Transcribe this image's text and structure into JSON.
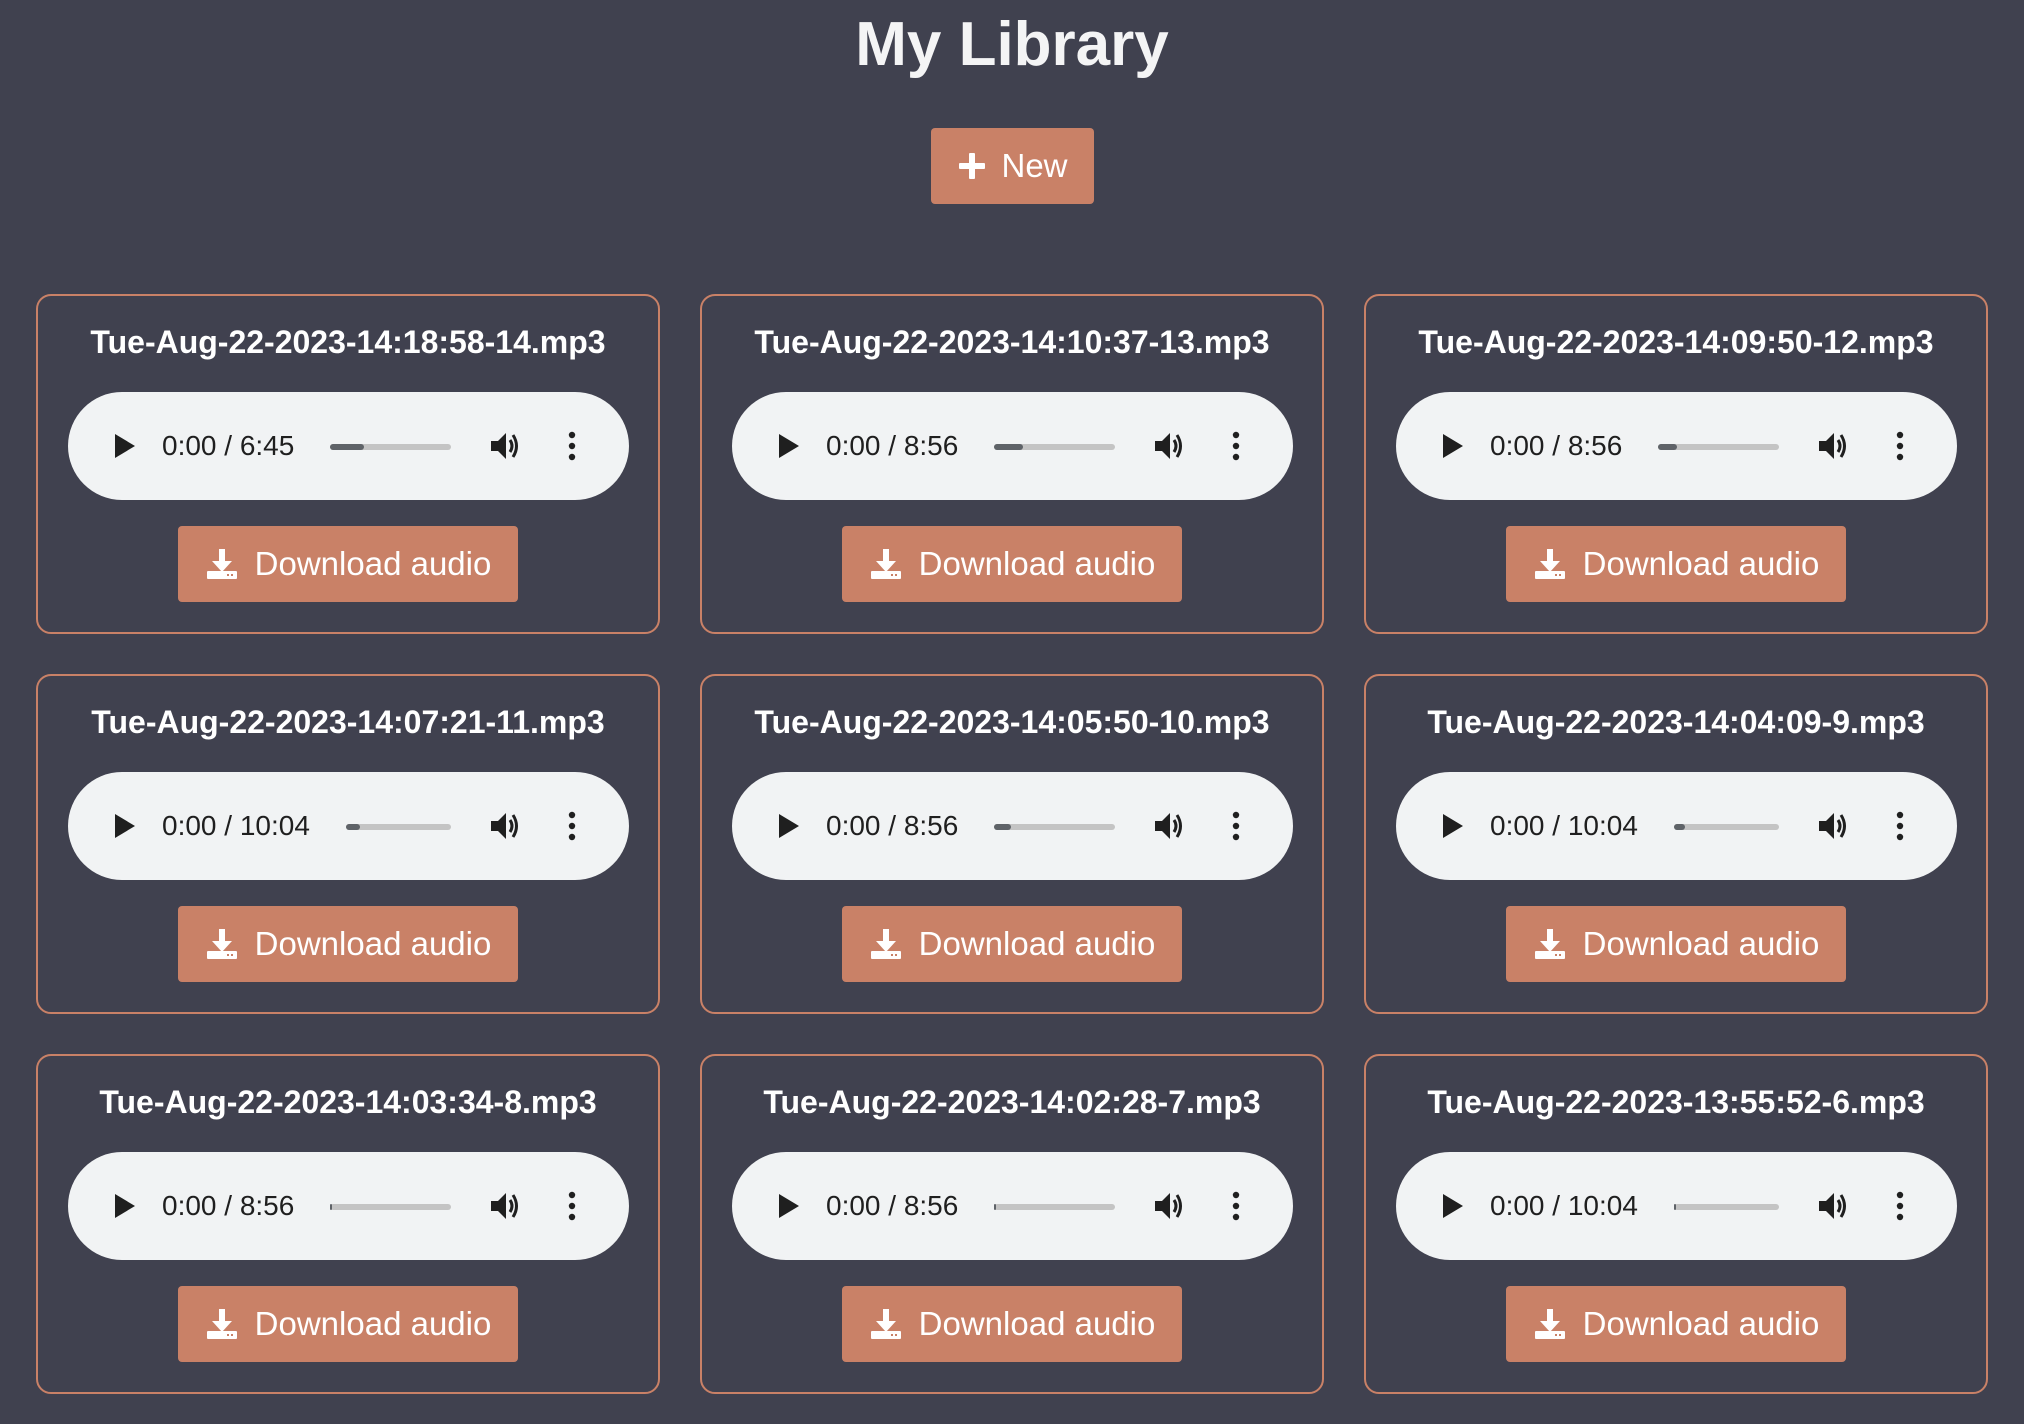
{
  "header": {
    "title": "My Library",
    "new_button_label": "New"
  },
  "colors": {
    "background": "#40414f",
    "accent": "#c98167",
    "player_background": "#f1f3f4"
  },
  "icons": {
    "new_button": "plus-icon",
    "download": "download-icon",
    "play": "play-icon",
    "volume": "volume-icon",
    "more": "more-vertical-icon"
  },
  "recordings": [
    {
      "filename": "Tue-Aug-22-2023-14:18:58-14.mp3",
      "time": "0:00 / 6:45",
      "download_label": "Download audio",
      "buffered_percent": 28
    },
    {
      "filename": "Tue-Aug-22-2023-14:10:37-13.mp3",
      "time": "0:00 / 8:56",
      "download_label": "Download audio",
      "buffered_percent": 24
    },
    {
      "filename": "Tue-Aug-22-2023-14:09:50-12.mp3",
      "time": "0:00 / 8:56",
      "download_label": "Download audio",
      "buffered_percent": 16
    },
    {
      "filename": "Tue-Aug-22-2023-14:07:21-11.mp3",
      "time": "0:00 / 10:04",
      "download_label": "Download audio",
      "buffered_percent": 13
    },
    {
      "filename": "Tue-Aug-22-2023-14:05:50-10.mp3",
      "time": "0:00 / 8:56",
      "download_label": "Download audio",
      "buffered_percent": 14
    },
    {
      "filename": "Tue-Aug-22-2023-14:04:09-9.mp3",
      "time": "0:00 / 10:04",
      "download_label": "Download audio",
      "buffered_percent": 10
    },
    {
      "filename": "Tue-Aug-22-2023-14:03:34-8.mp3",
      "time": "0:00 / 8:56",
      "download_label": "Download audio",
      "buffered_percent": 2
    },
    {
      "filename": "Tue-Aug-22-2023-14:02:28-7.mp3",
      "time": "0:00 / 8:56",
      "download_label": "Download audio",
      "buffered_percent": 2
    },
    {
      "filename": "Tue-Aug-22-2023-13:55:52-6.mp3",
      "time": "0:00 / 10:04",
      "download_label": "Download audio",
      "buffered_percent": 2
    }
  ]
}
